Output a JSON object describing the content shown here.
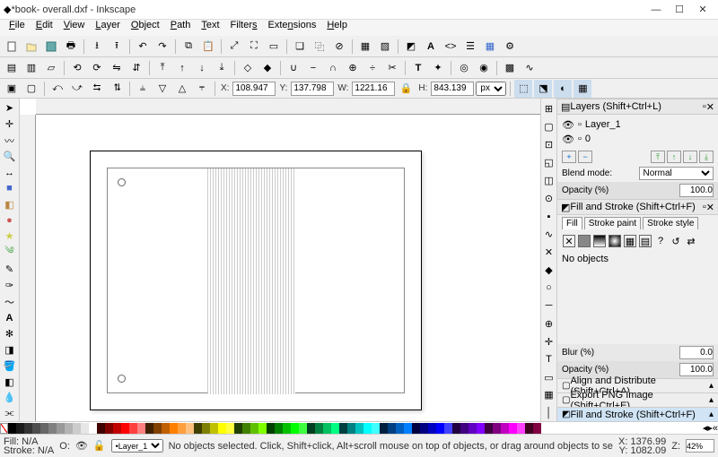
{
  "title": "*book- overall.dxf - Inkscape",
  "menu": [
    "File",
    "Edit",
    "View",
    "Layer",
    "Object",
    "Path",
    "Text",
    "Filters",
    "Extensions",
    "Help"
  ],
  "coords": {
    "x": "108.947",
    "y": "137.798",
    "w": "1221.16",
    "h": "843.139",
    "units": "px"
  },
  "layers_panel": {
    "title": "Layers (Shift+Ctrl+L)",
    "items": [
      {
        "name": "Layer_1"
      },
      {
        "name": "0"
      }
    ],
    "blend_label": "Blend mode:",
    "blend_value": "Normal",
    "opacity_label": "Opacity (%)",
    "opacity_value": "100.0"
  },
  "fillstroke_panel": {
    "title": "Fill and Stroke (Shift+Ctrl+F)",
    "tabs": [
      "Fill",
      "Stroke paint",
      "Stroke style"
    ],
    "no_obj": "No objects",
    "blur_label": "Blur (%)",
    "blur_value": "0.0",
    "opacity_label": "Opacity (%)",
    "opacity_value": "100.0"
  },
  "accordions": [
    "Align and Distribute (Shift+Ctrl+A)",
    "Export PNG Image (Shift+Ctrl+E)",
    "Fill and Stroke (Shift+Ctrl+F)"
  ],
  "status": {
    "fill_label": "Fill:",
    "stroke_label": "Stroke:",
    "na": "N/A",
    "layer": "Layer_1",
    "msg": "No objects selected. Click, Shift+click, Alt+scroll mouse on top of objects, or drag around objects to select.",
    "x": "X: 1376.99",
    "y": "Y: 1082.09",
    "zlabel": "Z:",
    "zoom": "42%"
  },
  "palette_colors": [
    "#000000",
    "#1a1a1a",
    "#333333",
    "#4d4d4d",
    "#666666",
    "#808080",
    "#999999",
    "#b3b3b3",
    "#cccccc",
    "#e6e6e6",
    "#ffffff",
    "#400000",
    "#800000",
    "#c00000",
    "#ff0000",
    "#ff4040",
    "#ff8080",
    "#402000",
    "#804000",
    "#c06000",
    "#ff8000",
    "#ffa040",
    "#ffc080",
    "#404000",
    "#808000",
    "#c0c000",
    "#ffff00",
    "#ffff40",
    "#204000",
    "#408000",
    "#60c000",
    "#80ff00",
    "#004000",
    "#008000",
    "#00c000",
    "#00ff00",
    "#40ff40",
    "#004020",
    "#008040",
    "#00c060",
    "#00ff80",
    "#004040",
    "#008080",
    "#00c0c0",
    "#00ffff",
    "#40ffff",
    "#002040",
    "#004080",
    "#0060c0",
    "#0080ff",
    "#000040",
    "#000080",
    "#0000c0",
    "#0000ff",
    "#4040ff",
    "#200040",
    "#400080",
    "#6000c0",
    "#8000ff",
    "#400040",
    "#800080",
    "#c000c0",
    "#ff00ff",
    "#ff40ff",
    "#400020",
    "#800040"
  ]
}
